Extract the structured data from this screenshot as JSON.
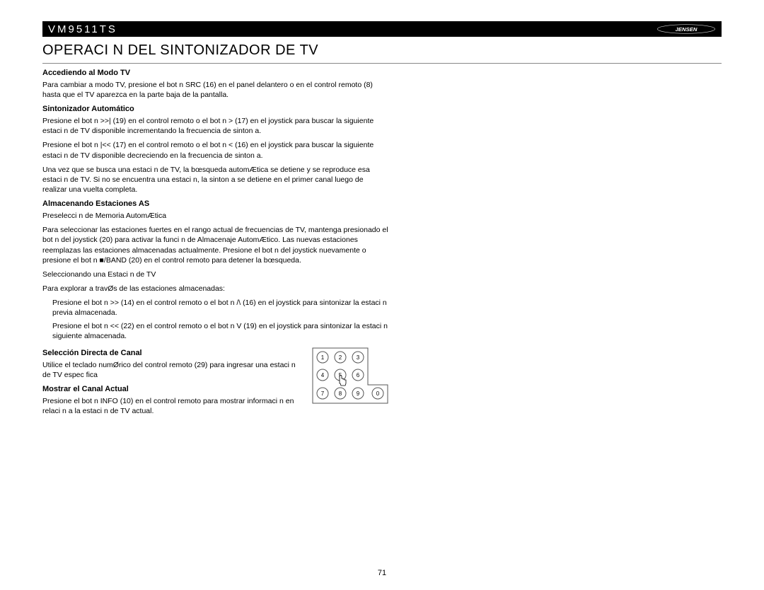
{
  "header": {
    "model": "VM9511TS",
    "brand": "JENSEN"
  },
  "title": "OPERACI N DEL SINTONIZADOR DE TV",
  "sections": {
    "s1": {
      "head": "Accediendo al Modo TV",
      "p1": "Para cambiar a modo TV, presione el bot n  SRC (16) en el panel delantero o en el control remoto (8) hasta que el TV aparezca en la parte baja de la pantalla."
    },
    "s2": {
      "head": "Sintonizador Automático",
      "p1": "Presione el bot n  >>| (19) en el control remoto o el bot n  > (17) en el joystick para buscar la siguiente estaci n de TV disponible incrementando la frecuencia de sinton a.",
      "p2": "Presione el bot n  |<< (17) en el control remoto o el bot n  < (16) en el joystick para buscar la siguiente estaci n de TV disponible decreciendo en la frecuencia de sinton a.",
      "p3": "Una vez que se busca una estaci n de TV, la bœsqueda automÆtica se detiene y se reproduce esa estaci n de TV. Si no se encuentra una estaci n, la sinton a se detiene en el primer canal luego de realizar una vuelta completa."
    },
    "s3": {
      "head": "Almacenando Estaciones AS",
      "sub1": "Preselecci n de Memoria AutomÆtica",
      "p1": "Para seleccionar las estaciones fuertes en el rango actual de frecuencias de TV, mantenga presionado el bot n del joystick (20) para activar la funci n de Almacenaje AutomÆtico. Las nuevas estaciones reemplazas las estaciones almacenadas actualmente. Presione el bot n del joystick nuevamente o presione el bot n  ■/BAND (20) en el control remoto para detener la bœsqueda.",
      "sub2": "Seleccionando una Estaci n de TV",
      "p2": "Para explorar a travØs de las estaciones almacenadas:",
      "b1": "Presione el bot n  >> (14) en el control remoto o el bot n /\\ (16) en el joystick para sintonizar la estaci n previa almacenada.",
      "b2": "Presione el bot n  << (22) en el control remoto o el bot n V (19) en el joystick para sintonizar la estaci n siguiente almacenada."
    },
    "s4": {
      "head": "Selección Directa de Canal",
      "p1": "Utilice el teclado numØrico del control remoto (29) para ingresar una estaci n de TV espec fica"
    },
    "s5": {
      "head": "Mostrar el Canal Actual",
      "p1": "Presione el bot n  INFO (10) en el control remoto para mostrar informaci n en relaci n a la estaci n de TV actual."
    }
  },
  "keypad": [
    "1",
    "2",
    "3",
    "4",
    "5",
    "6",
    "7",
    "8",
    "9",
    "0"
  ],
  "page_number": "71"
}
